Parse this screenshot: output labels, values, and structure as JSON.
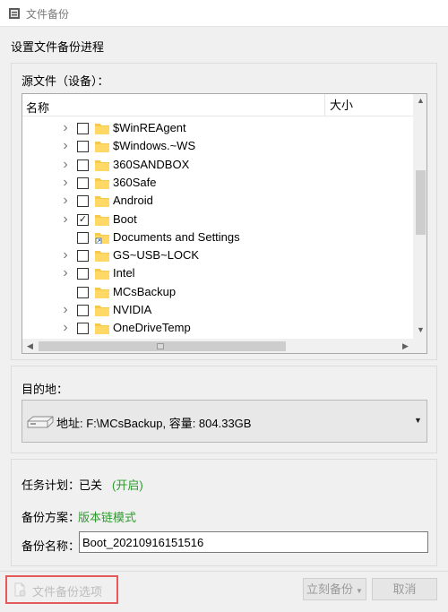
{
  "window": {
    "title": "文件备份",
    "heading": "设置文件备份进程"
  },
  "source": {
    "label": "源文件（设备）：",
    "columns": {
      "name": "名称",
      "size": "大小"
    },
    "rows": [
      {
        "label": "$WinREAgent",
        "expandable": true,
        "checked": false,
        "icon": "folder-icon"
      },
      {
        "label": "$Windows.~WS",
        "expandable": true,
        "checked": false,
        "icon": "folder-icon"
      },
      {
        "label": "360SANDBOX",
        "expandable": true,
        "checked": false,
        "icon": "folder-icon"
      },
      {
        "label": "360Safe",
        "expandable": true,
        "checked": false,
        "icon": "folder-icon"
      },
      {
        "label": "Android",
        "expandable": true,
        "checked": false,
        "icon": "folder-icon"
      },
      {
        "label": "Boot",
        "expandable": true,
        "checked": true,
        "icon": "folder-icon"
      },
      {
        "label": "Documents and Settings",
        "expandable": false,
        "checked": false,
        "icon": "folder-shortcut-icon"
      },
      {
        "label": "GS~USB~LOCK",
        "expandable": true,
        "checked": false,
        "icon": "folder-icon"
      },
      {
        "label": "Intel",
        "expandable": true,
        "checked": false,
        "icon": "folder-icon"
      },
      {
        "label": "MCsBackup",
        "expandable": false,
        "checked": false,
        "icon": "folder-icon"
      },
      {
        "label": "NVIDIA",
        "expandable": true,
        "checked": false,
        "icon": "folder-icon"
      },
      {
        "label": "OneDriveTemp",
        "expandable": true,
        "checked": false,
        "icon": "folder-icon"
      }
    ]
  },
  "destination": {
    "label": "目的地：",
    "value": "地址: F:\\MCsBackup, 容量: 804.33GB"
  },
  "task": {
    "plan_label": "任务计划：",
    "plan_value": "已关",
    "plan_link": "(开启)",
    "scheme_label": "备份方案：",
    "scheme_link": "版本链模式",
    "name_label": "备份名称：",
    "name_value": "Boot_20210916151516"
  },
  "footer": {
    "options_label": "文件备份选项",
    "backup_button": "立刻备份",
    "cancel_button": "取消"
  },
  "colors": {
    "link_green": "#2e9a2e",
    "folder_yellow": "#f6c94a",
    "highlight_red": "#e45a5a"
  }
}
